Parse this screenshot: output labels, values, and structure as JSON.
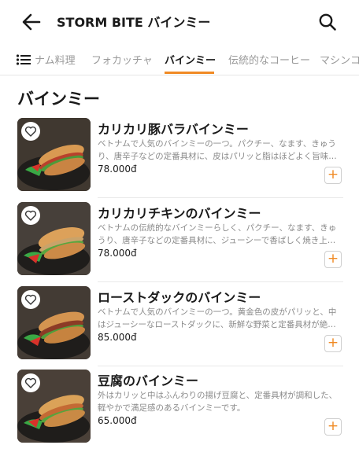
{
  "header": {
    "back_icon": "arrow-left-icon",
    "title": "STORM BITE バインミー",
    "search_icon": "search-icon"
  },
  "tabs": [
    {
      "label": "ナム料理",
      "active": false
    },
    {
      "label": "フォカッチャ",
      "active": false
    },
    {
      "label": "バインミー",
      "active": true
    },
    {
      "label": "伝統的なコーヒー",
      "active": false
    },
    {
      "label": "マシンコ",
      "active": false
    }
  ],
  "accent_color": "#f08a24",
  "section": {
    "title": "バインミー"
  },
  "items": [
    {
      "name": "カリカリ豚バラバインミー",
      "description": "ベトナムで人気のバインミーの一つ。パクチー、なます、きゅうり、唐辛子などの定番具材に、皮はパリッと脂はほどよく旨味…",
      "price": "78.000đ",
      "add_label": "+"
    },
    {
      "name": "カリカリチキンのバインミー",
      "description": "ベトナムの伝統的なバインミーらしく、パクチー、なます、きゅうり、唐辛子などの定番具材に、ジューシーで香ばしく焼き上…",
      "price": "78.000đ",
      "add_label": "+"
    },
    {
      "name": "ローストダックのバインミー",
      "description": "ベトナムで人気のバインミーの一つ。黄金色の皮がパリッと、中はジューシーなローストダックに、新鮮な野菜と定番具材が絶…",
      "price": "85.000đ",
      "add_label": "+"
    },
    {
      "name": "豆腐のバインミー",
      "description": "外はカリッと中はふんわりの揚げ豆腐と、定番具材が調和した、軽やかで満足感のあるバインミーです。",
      "price": "65.000đ",
      "add_label": "+"
    }
  ]
}
